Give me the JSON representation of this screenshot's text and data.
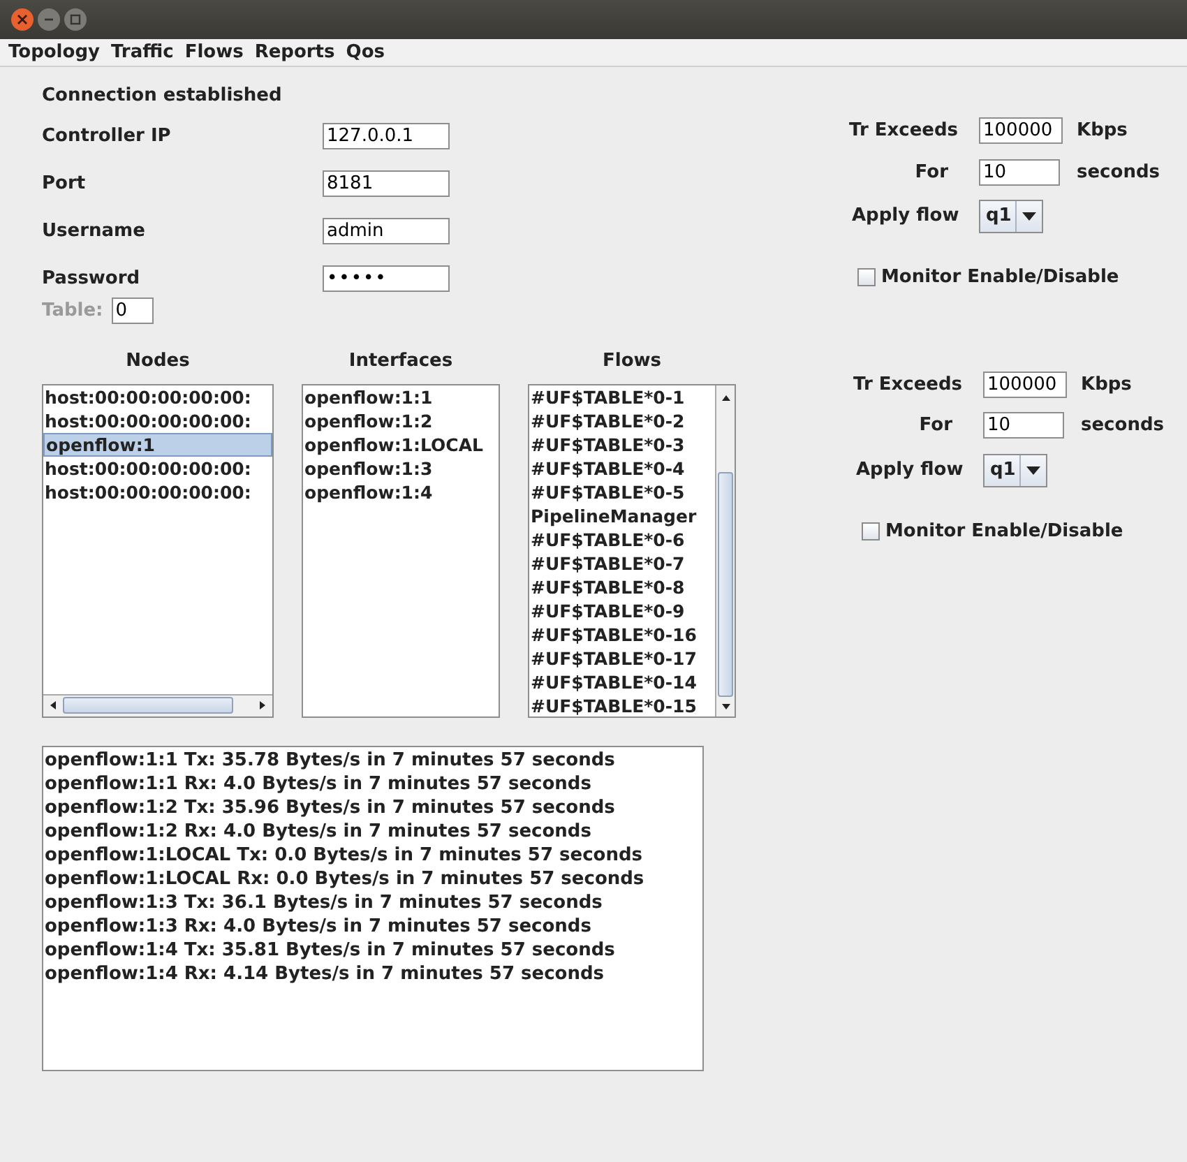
{
  "menu": [
    {
      "label": "Topology"
    },
    {
      "label": "Traffic"
    },
    {
      "label": "Flows"
    },
    {
      "label": "Reports"
    },
    {
      "label": "Qos"
    }
  ],
  "status": "Connection established",
  "form": [
    {
      "label": "Controller IP",
      "value": "127.0.0.1",
      "kind": "text"
    },
    {
      "label": "Port",
      "value": "8181",
      "kind": "text"
    },
    {
      "label": "Username",
      "value": "admin",
      "kind": "text"
    },
    {
      "label": "Password",
      "value": "•••••",
      "kind": "password"
    }
  ],
  "table": {
    "label": "Table:",
    "value": "0",
    "disabled": true
  },
  "lists": [
    {
      "heading": "Nodes",
      "kind": "hscroll",
      "items": [
        {
          "text": "host:00:00:00:00:00:",
          "selected": false
        },
        {
          "text": "host:00:00:00:00:00:",
          "selected": false
        },
        {
          "text": "openflow:1",
          "selected": true
        },
        {
          "text": "host:00:00:00:00:00:",
          "selected": false
        },
        {
          "text": "host:00:00:00:00:00:",
          "selected": false
        }
      ]
    },
    {
      "heading": "Interfaces",
      "kind": "plain",
      "items": [
        {
          "text": "openflow:1:1",
          "selected": false
        },
        {
          "text": "openflow:1:2",
          "selected": false
        },
        {
          "text": "openflow:1:LOCAL",
          "selected": false
        },
        {
          "text": "openflow:1:3",
          "selected": false
        },
        {
          "text": "openflow:1:4",
          "selected": false
        }
      ]
    },
    {
      "heading": "Flows",
      "kind": "vscroll",
      "items": [
        {
          "text": "#UF$TABLE*0-1",
          "selected": false
        },
        {
          "text": "#UF$TABLE*0-2",
          "selected": false
        },
        {
          "text": "#UF$TABLE*0-3",
          "selected": false
        },
        {
          "text": "#UF$TABLE*0-4",
          "selected": false
        },
        {
          "text": "#UF$TABLE*0-5",
          "selected": false
        },
        {
          "text": "PipelineManager",
          "selected": false
        },
        {
          "text": "#UF$TABLE*0-6",
          "selected": false
        },
        {
          "text": "#UF$TABLE*0-7",
          "selected": false
        },
        {
          "text": "#UF$TABLE*0-8",
          "selected": false
        },
        {
          "text": "#UF$TABLE*0-9",
          "selected": false
        },
        {
          "text": "#UF$TABLE*0-16",
          "selected": false
        },
        {
          "text": "#UF$TABLE*0-17",
          "selected": false
        },
        {
          "text": "#UF$TABLE*0-14",
          "selected": false
        },
        {
          "text": "#UF$TABLE*0-15",
          "selected": false
        }
      ]
    }
  ],
  "log": [
    "openflow:1:1 Tx: 35.78 Bytes/s in 7 minutes 57 seconds",
    "openflow:1:1 Rx: 4.0 Bytes/s in 7 minutes 57 seconds",
    "openflow:1:2 Tx: 35.96 Bytes/s in 7 minutes 57 seconds",
    "openflow:1:2 Rx: 4.0 Bytes/s in 7 minutes 57 seconds",
    "openflow:1:LOCAL Tx: 0.0 Bytes/s in 7 minutes 57 seconds",
    "openflow:1:LOCAL Rx: 0.0 Bytes/s in 7 minutes 57 seconds",
    "openflow:1:3 Tx: 36.1 Bytes/s in 7 minutes 57 seconds",
    "openflow:1:3 Rx: 4.0 Bytes/s in 7 minutes 57 seconds",
    "openflow:1:4 Tx: 35.81 Bytes/s in 7 minutes 57 seconds",
    "openflow:1:4 Rx: 4.14 Bytes/s in 7 minutes 57 seconds"
  ],
  "monitors": [
    {
      "tr_label": "Tr Exceeds",
      "tr_value": "100000",
      "tr_unit": "Kbps",
      "for_label": "For",
      "for_value": "10",
      "for_unit": "seconds",
      "apply_label": "Apply flow",
      "apply_value": "q1",
      "check_label": "Monitor Enable/Disable",
      "checked": false
    },
    {
      "tr_label": "Tr Exceeds",
      "tr_value": "100000",
      "tr_unit": "Kbps",
      "for_label": "For",
      "for_value": "10",
      "for_unit": "seconds",
      "apply_label": "Apply flow",
      "apply_value": "q1",
      "check_label": "Monitor Enable/Disable",
      "checked": false
    }
  ]
}
